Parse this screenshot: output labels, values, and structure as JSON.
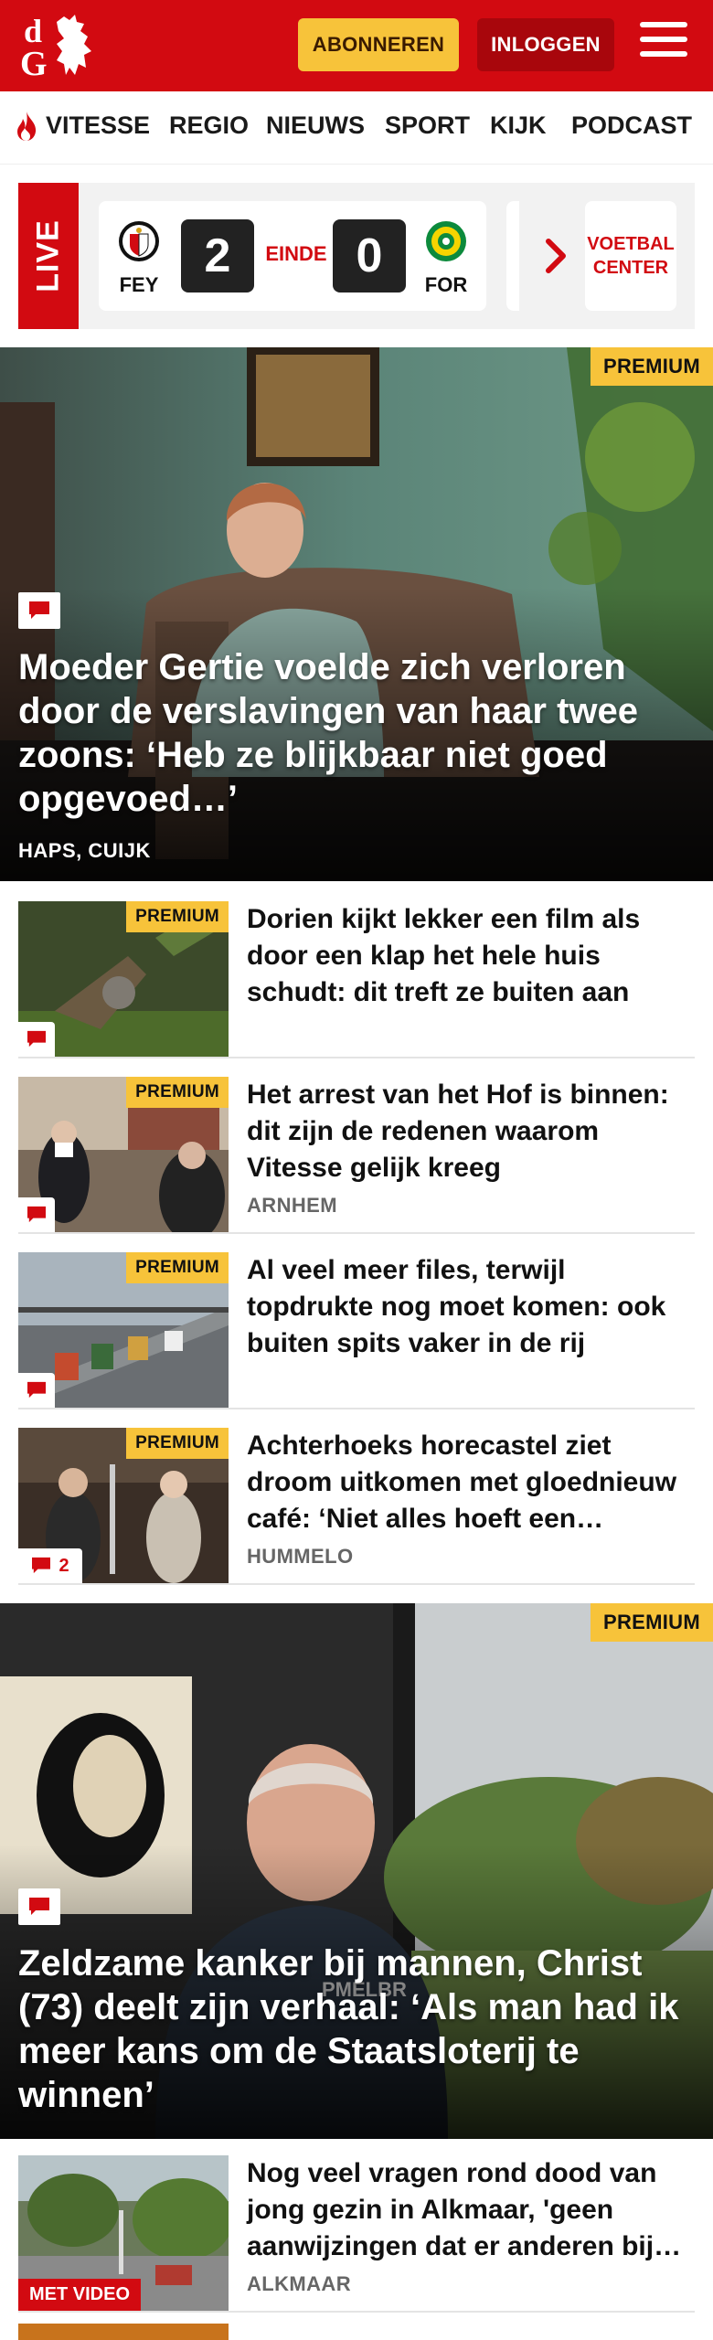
{
  "header": {
    "subscribe_label": "ABONNEREN",
    "login_label": "INLOGGEN",
    "brand_color": "#d20a11",
    "accent_color": "#f7c33a"
  },
  "nav": {
    "items": [
      {
        "label": "VITESSE",
        "icon": "flame-icon"
      },
      {
        "label": "REGIO"
      },
      {
        "label": "NIEUWS"
      },
      {
        "label": "SPORT"
      },
      {
        "label": "KIJK"
      },
      {
        "label": "PODCAST"
      }
    ]
  },
  "live": {
    "label": "LIVE",
    "match": {
      "home_team": "FEY",
      "away_team": "FOR",
      "home_score": "2",
      "away_score": "0",
      "status": "EINDE"
    },
    "center_label_line1": "VOETBAL",
    "center_label_line2": "CENTER"
  },
  "hero1": {
    "badge": "PREMIUM",
    "title": "Moeder Gertie voelde zich verloren door de verslavingen van haar twee zoons: ‘Heb ze blijkbaar niet goed opgevoed…’",
    "location": "HAPS, CUIJK",
    "comment_icon": "comment-icon"
  },
  "articles": [
    {
      "badge": "PREMIUM",
      "title": "Dorien kijkt lekker een film als door een klap het hele huis schudt: dit treft ze buiten aan",
      "location": "",
      "comments": ""
    },
    {
      "badge": "PREMIUM",
      "title": "Het arrest van het Hof is binnen: dit zijn de redenen waarom Vitesse gelijk kreeg",
      "location": "ARNHEM",
      "comments": ""
    },
    {
      "badge": "PREMIUM",
      "title": "Al veel meer files, terwijl topdrukte nog moet komen: ook buiten spits vaker in de rij",
      "location": "",
      "comments": ""
    },
    {
      "badge": "PREMIUM",
      "title": "Achterhoeks horecastel ziet droom uitkomen met gloednieuw café: ‘Niet alles hoeft een…",
      "location": "HUMMELO",
      "comments": "2"
    }
  ],
  "hero2": {
    "badge": "PREMIUM",
    "title": "Zeldzame kanker bij mannen, Christ (73) deelt zijn verhaal: ‘Als man had ik meer kans om de Staatsloterij te winnen’",
    "comment_icon": "comment-icon"
  },
  "articles2": [
    {
      "video_label": "MET VIDEO",
      "title": "Nog veel vragen rond dood van jong gezin in Alkmaar, 'geen aanwijzingen dat er anderen bij…",
      "location": "ALKMAAR"
    }
  ]
}
